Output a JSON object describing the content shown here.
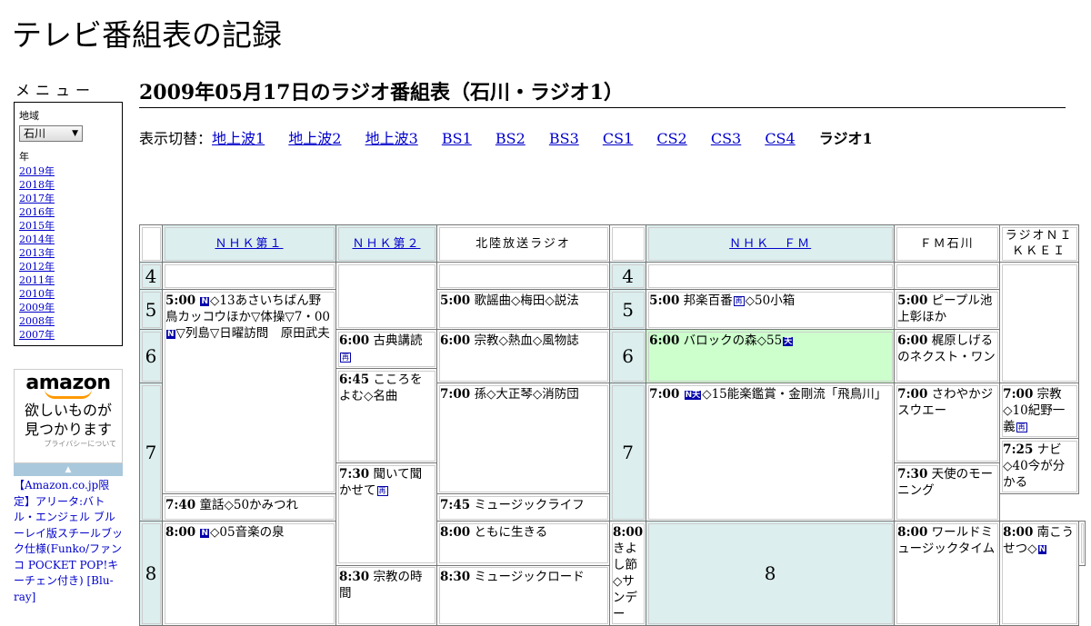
{
  "site": {
    "title": "テレビ番組表の記録"
  },
  "menu": {
    "title": "メニュー",
    "region_label": "地域",
    "region_value": "石川",
    "year_label": "年",
    "years": [
      "2019年",
      "2018年",
      "2017年",
      "2016年",
      "2015年",
      "2014年",
      "2013年",
      "2012年",
      "2011年",
      "2010年",
      "2009年",
      "2008年",
      "2007年"
    ]
  },
  "ad": {
    "logo": "amazon",
    "tagline1": "欲しいものが",
    "tagline2": "見つかります",
    "privacy": "プライバシーについて",
    "bar": "▲",
    "text": "【Amazon.co.jp限定】アリータ:バトル・エンジェル ブルーレイ版スチールブック仕様(Funko/ファンコ POCKET POP!キーチェン付き) [Blu-ray]"
  },
  "main": {
    "title": "2009年05月17日のラジオ番組表（石川・ラジオ1）",
    "switch_label": "表示切替：",
    "switch_links": [
      "地上波1",
      "地上波2",
      "地上波3",
      "BS1",
      "BS2",
      "BS3",
      "CS1",
      "CS2",
      "CS3",
      "CS4"
    ],
    "switch_current": "ラジオ1"
  },
  "grid": {
    "channels": [
      "ＮＨＫ第１",
      "ＮＨＫ第２",
      "北陸放送ラジオ",
      "ＮＨＫ　ＦＭ",
      "ＦＭ石川",
      "ラジオＮＩＫＫＥＩ"
    ],
    "hours": [
      "4",
      "5",
      "6",
      "7",
      "8"
    ],
    "programs": {
      "nhk1_500": {
        "time": "5:00",
        "icon": "N",
        "text": "◇13あさいちばん野鳥カッコウほか▽体操▽7・00",
        "icon2": "N",
        "text2": "▽列島▽日曜訪問　原田武夫"
      },
      "nhk1_800": {
        "time": "8:00",
        "icon": "N",
        "text": "◇05音楽の泉"
      },
      "nhk2_600": {
        "time": "6:00",
        "text": "古典講読",
        "icon": "再"
      },
      "nhk2_645": {
        "time": "6:45",
        "text": "こころをよむ◇名曲"
      },
      "nhk2_730": {
        "time": "7:30",
        "text": "聞いて聞かせて",
        "icon": "再"
      },
      "nhk2_800": {
        "time": "8:00",
        "text": "ともに生きる"
      },
      "nhk2_830": {
        "time": "8:30",
        "text": "宗教の時間"
      },
      "mro_500": {
        "time": "5:00",
        "text": "歌謡曲◇梅田◇説法"
      },
      "mro_600": {
        "time": "6:00",
        "text": "宗教◇熱血◇風物誌"
      },
      "mro_700": {
        "time": "7:00",
        "text": "孫◇大正琴◇消防団"
      },
      "mro_740": {
        "time": "7:40",
        "text": "童話◇50かみつれ"
      },
      "mro_800": {
        "time": "8:00",
        "text": "きよし節◇サンデー"
      },
      "fm_500": {
        "time": "5:00",
        "text": "邦楽百番",
        "icon": "再",
        "text2": "◇50小箱"
      },
      "fm_600": {
        "time": "6:00",
        "text": "バロックの森◇55",
        "icon": "天"
      },
      "fm_700": {
        "time": "7:00",
        "icon": "N天",
        "text": "◇15能楽鑑賞・金剛流「飛鳥川」"
      },
      "fm_800": {
        "time": "8:00",
        "text": "ワールドミュージックタイム"
      },
      "fmi_500": {
        "time": "5:00",
        "text": "ピープル池上彰ほか"
      },
      "fmi_600": {
        "time": "6:00",
        "text": "梶原しげるのネクスト・ワン"
      },
      "fmi_700": {
        "time": "7:00",
        "text": "さわやかジスウエー"
      },
      "fmi_730": {
        "time": "7:30",
        "text": "天使のモーニング"
      },
      "fmi_800": {
        "time": "8:00",
        "text": "南こうせつ◇",
        "icon": "N"
      },
      "nikkei_700": {
        "time": "7:00",
        "text": "宗教◇10紀野一義",
        "icon": "再"
      },
      "nikkei_725": {
        "time": "7:25",
        "text": "ナビ◇40今が分かる"
      },
      "nikkei_745": {
        "time": "7:45",
        "text": "ミュージックライフ"
      },
      "nikkei_830": {
        "time": "8:30",
        "text": "ミュージックロード"
      }
    }
  },
  "colors": {
    "header_bg": "#dceeee",
    "highlight_bg": "#ccffcc",
    "link": "#0000cc",
    "icon_bg": "#0000aa"
  }
}
